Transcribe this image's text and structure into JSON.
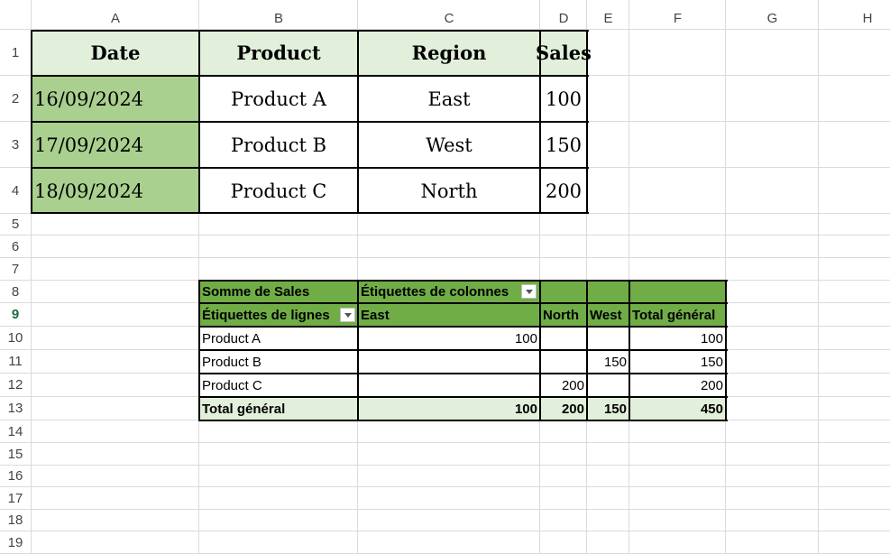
{
  "columns": [
    "A",
    "B",
    "C",
    "D",
    "E",
    "F",
    "G",
    "H"
  ],
  "rows": [
    "1",
    "2",
    "3",
    "4",
    "5",
    "6",
    "7",
    "8",
    "9",
    "10",
    "11",
    "12",
    "13",
    "14",
    "15",
    "16",
    "17",
    "18",
    "19"
  ],
  "active_row": "9",
  "table": {
    "headers": [
      "Date",
      "Product",
      "Region",
      "Sales"
    ],
    "rows": [
      [
        "16/09/2024",
        "Product A",
        "East",
        "100"
      ],
      [
        "17/09/2024",
        "Product B",
        "West",
        "150"
      ],
      [
        "18/09/2024",
        "Product C",
        "North",
        "200"
      ]
    ]
  },
  "pivot": {
    "values_label": "Somme de Sales",
    "column_labels": "Étiquettes de colonnes",
    "row_labels": "Étiquettes de lignes",
    "col_headers": [
      "East",
      "North",
      "West",
      "Total général"
    ],
    "rows": [
      {
        "label": "Product A",
        "values": [
          "100",
          "",
          "",
          "100"
        ]
      },
      {
        "label": "Product B",
        "values": [
          "",
          "",
          "150",
          "150"
        ]
      },
      {
        "label": "Product C",
        "values": [
          "",
          "200",
          "",
          "200"
        ]
      }
    ],
    "total_label": "Total général",
    "totals": [
      "100",
      "200",
      "150",
      "450"
    ]
  },
  "colors": {
    "header_fill": "#e2efda",
    "date_fill": "#a9d08e",
    "pivot_header_fill": "#70ad47",
    "pivot_total_fill": "#e2efda",
    "gridline": "#dadada"
  }
}
